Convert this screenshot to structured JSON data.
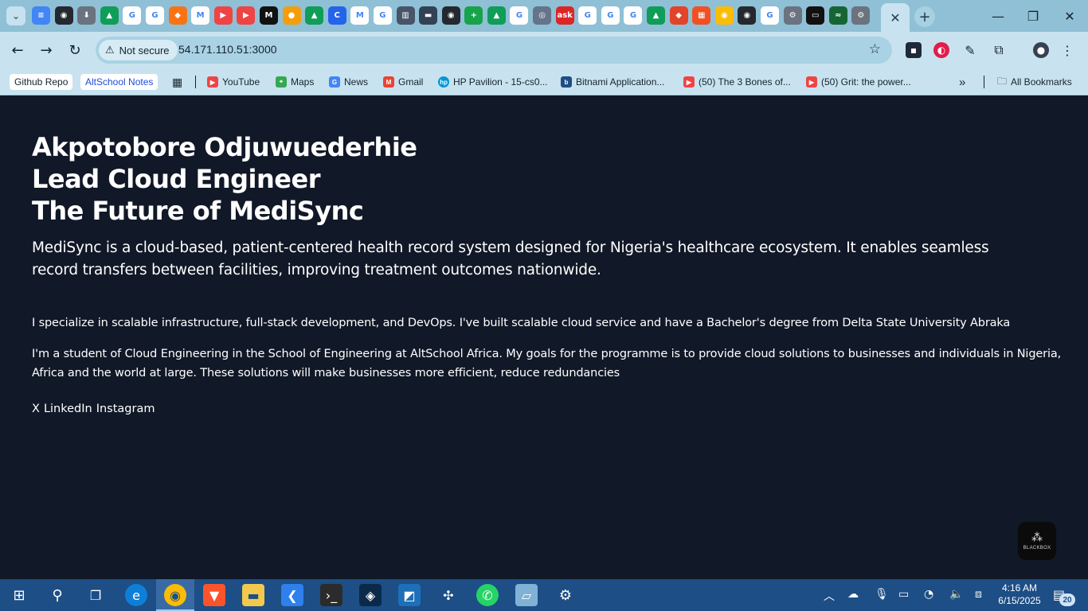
{
  "browser": {
    "tab_icons": [
      {
        "name": "google-docs-icon",
        "color": "#4285f4",
        "glyph": "≡"
      },
      {
        "name": "github-icon",
        "color": "#24292f",
        "glyph": "◉"
      },
      {
        "name": "download-icon",
        "color": "#6b7280",
        "glyph": "⬇"
      },
      {
        "name": "google-drive-icon",
        "color": "#0f9d58",
        "glyph": "▲"
      },
      {
        "name": "google-icon",
        "color": "#ffffff",
        "glyph": "G"
      },
      {
        "name": "google-icon",
        "color": "#ffffff",
        "glyph": "G"
      },
      {
        "name": "app-icon",
        "color": "#f97316",
        "glyph": "◆"
      },
      {
        "name": "gmail-icon",
        "color": "#ffffff",
        "glyph": "M"
      },
      {
        "name": "youtube-icon",
        "color": "#ef4444",
        "glyph": "▶"
      },
      {
        "name": "youtube-icon",
        "color": "#ef4444",
        "glyph": "▶"
      },
      {
        "name": "medium-icon",
        "color": "#111111",
        "glyph": "M"
      },
      {
        "name": "app-icon",
        "color": "#f59e0b",
        "glyph": "●"
      },
      {
        "name": "google-drive-icon",
        "color": "#0f9d58",
        "glyph": "▲"
      },
      {
        "name": "app-icon",
        "color": "#2563eb",
        "glyph": "C"
      },
      {
        "name": "gmail-icon",
        "color": "#ffffff",
        "glyph": "M"
      },
      {
        "name": "google-icon",
        "color": "#ffffff",
        "glyph": "G"
      },
      {
        "name": "bank-icon",
        "color": "#475569",
        "glyph": "▥"
      },
      {
        "name": "app-icon",
        "color": "#334155",
        "glyph": "▬"
      },
      {
        "name": "github-icon",
        "color": "#24292f",
        "glyph": "◉"
      },
      {
        "name": "app-icon",
        "color": "#16a34a",
        "glyph": "+"
      },
      {
        "name": "google-drive-icon",
        "color": "#0f9d58",
        "glyph": "▲"
      },
      {
        "name": "google-icon",
        "color": "#ffffff",
        "glyph": "G"
      },
      {
        "name": "globe-icon",
        "color": "#64748b",
        "glyph": "◎"
      },
      {
        "name": "ask-icon",
        "color": "#dc2626",
        "glyph": "ask"
      },
      {
        "name": "google-icon",
        "color": "#ffffff",
        "glyph": "G"
      },
      {
        "name": "google-icon",
        "color": "#ffffff",
        "glyph": "G"
      },
      {
        "name": "google-icon",
        "color": "#ffffff",
        "glyph": "G"
      },
      {
        "name": "google-drive-icon",
        "color": "#0f9d58",
        "glyph": "▲"
      },
      {
        "name": "gitlab-icon",
        "color": "#e24329",
        "glyph": "◆"
      },
      {
        "name": "microsoft-icon",
        "color": "#f25022",
        "glyph": "▦"
      },
      {
        "name": "chrome-icon",
        "color": "#fbbc05",
        "glyph": "◉"
      },
      {
        "name": "github-icon",
        "color": "#24292f",
        "glyph": "◉"
      },
      {
        "name": "google-icon",
        "color": "#ffffff",
        "glyph": "G"
      },
      {
        "name": "settings-icon",
        "color": "#6b7280",
        "glyph": "⚙"
      },
      {
        "name": "app-icon",
        "color": "#111111",
        "glyph": "▭"
      },
      {
        "name": "app-icon",
        "color": "#166534",
        "glyph": "≈"
      },
      {
        "name": "settings-icon",
        "color": "#6b7280",
        "glyph": "⚙"
      }
    ],
    "active_tab_close": "✕",
    "new_tab": "+",
    "window_controls": {
      "minimize": "—",
      "maximize": "❐",
      "close": "✕"
    },
    "nav": {
      "back": "←",
      "forward": "→",
      "reload": "↻"
    },
    "security_label": "Not secure",
    "url": "54.171.110.51:3000",
    "bookmarks": [
      {
        "label": "Github Repo",
        "chip": true
      },
      {
        "label": "AltSchool Notes",
        "chip": true
      },
      {
        "label": "YouTube",
        "icon_color": "#ef4444"
      },
      {
        "label": "Maps",
        "icon_color": "#34a853"
      },
      {
        "label": "News",
        "icon_color": "#4285f4"
      },
      {
        "label": "Gmail",
        "icon_color": "#ea4335"
      },
      {
        "label": "HP Pavilion - 15-cs0...",
        "icon_color": "#0096d6"
      },
      {
        "label": "Bitnami Application...",
        "icon_color": "#1d4e86"
      },
      {
        "label": "(50) The 3 Bones of...",
        "icon_color": "#ef4444"
      },
      {
        "label": "(50) Grit: the power...",
        "icon_color": "#ef4444"
      }
    ],
    "bookmarks_more": "»",
    "all_bookmarks": "All Bookmarks"
  },
  "page": {
    "heading_lines": [
      "Akpotobore Odjuwuederhie",
      "Lead Cloud Engineer",
      "The Future of MediSync"
    ],
    "lead": "MediSync is a cloud-based, patient-centered health record system designed for Nigeria's healthcare ecosystem. It enables seamless record transfers between facilities, improving treatment outcomes nationwide.",
    "paragraph_1": "I specialize in scalable infrastructure, full-stack development, and DevOps. I've built scalable cloud service and have a Bachelor's degree from Delta State University Abraka",
    "paragraph_2": "I'm a student of Cloud Engineering in the School of Engineering at AltSchool Africa. My goals for the programme is to provide cloud solutions to businesses and individuals in Nigeria, Africa and the world at large. These solutions will make businesses more efficient, reduce redundancies",
    "socials": [
      "X",
      "LinkedIn",
      "Instagram"
    ],
    "blackbox_label": "BLACKBOX"
  },
  "taskbar": {
    "time": "4:16 AM",
    "date": "6/15/2025",
    "notification_count": "20"
  }
}
